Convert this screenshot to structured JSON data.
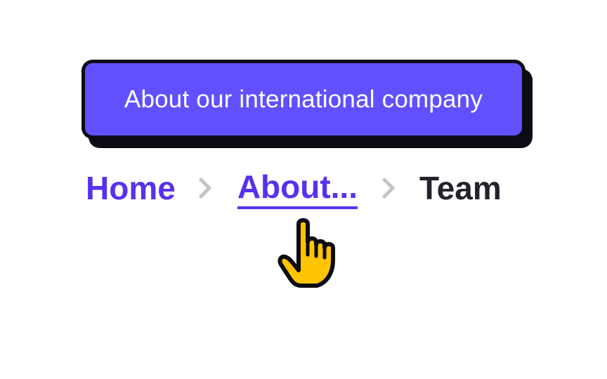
{
  "tooltip": {
    "text": "About our international company"
  },
  "breadcrumb": {
    "items": [
      {
        "label": "Home"
      },
      {
        "label": "About..."
      },
      {
        "label": "Team"
      }
    ]
  },
  "colors": {
    "accent": "#5632ee",
    "tooltip_bg": "#6150ff",
    "tooltip_border": "#0c0c14",
    "current": "#24232b",
    "separator": "#c4c4c8",
    "cursor_fill": "#ffc400"
  },
  "icons": {
    "separator": "chevron-right-icon",
    "cursor": "hand-pointer-cursor-icon"
  }
}
